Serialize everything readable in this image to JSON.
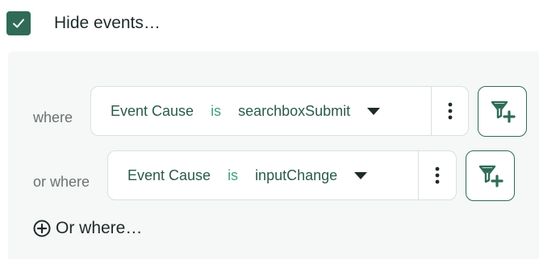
{
  "hide_events": {
    "label": "Hide events…",
    "checked": true
  },
  "conditions": [
    {
      "prefix": "where",
      "field": "Event Cause",
      "operator": "is",
      "value": "searchboxSubmit"
    },
    {
      "prefix": "or where",
      "field": "Event Cause",
      "operator": "is",
      "value": "inputChange"
    }
  ],
  "add_or_where": {
    "label": "Or where…"
  },
  "colors": {
    "accent": "#2f6b57",
    "operator": "#3fa07f",
    "panel_bg": "#f6f7f7"
  },
  "icons": {
    "checkbox": "check-icon",
    "menu": "kebab-menu-icon",
    "filter": "filter-add-icon",
    "add": "plus-circle-icon",
    "dropdown": "caret-down-icon"
  }
}
